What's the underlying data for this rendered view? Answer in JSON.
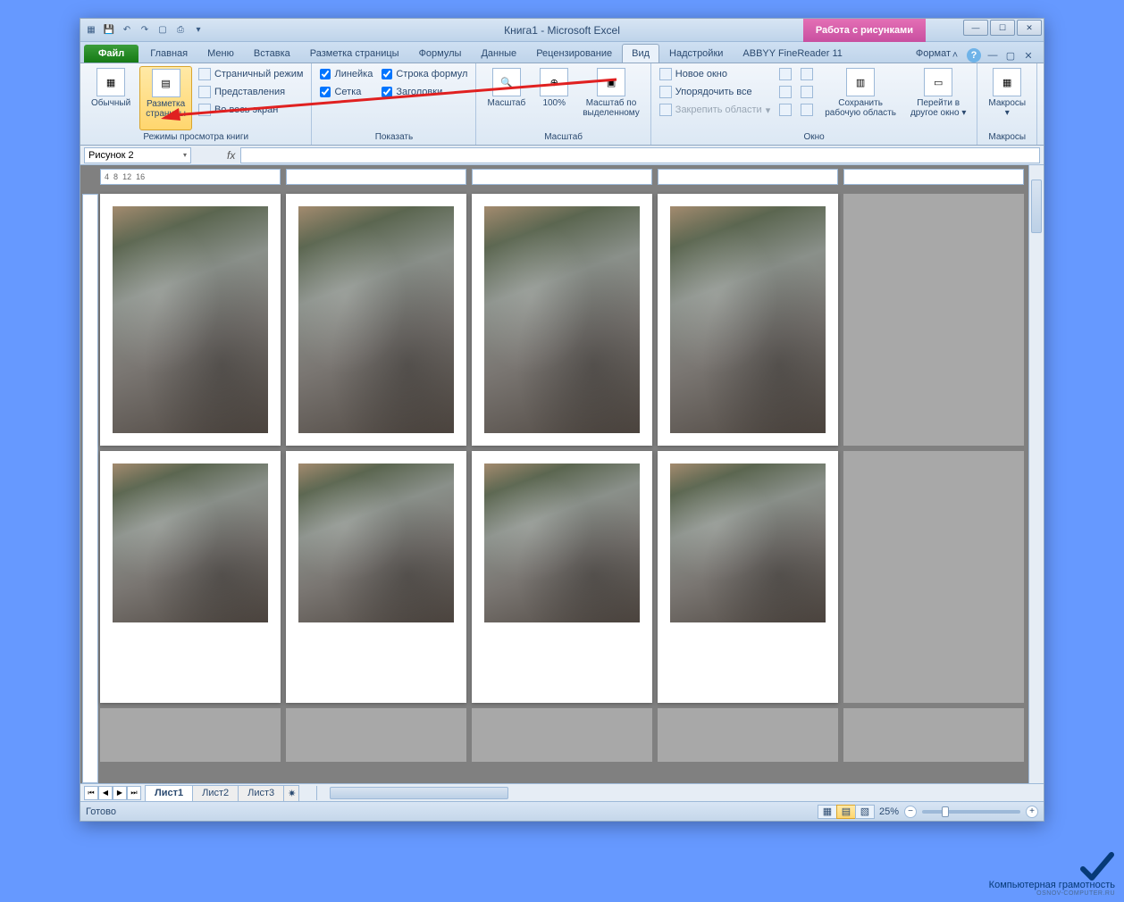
{
  "titlebar": {
    "title": "Книга1 - Microsoft Excel",
    "contextual": "Работа с рисунками"
  },
  "tabs": {
    "file": "Файл",
    "items": [
      "Главная",
      "Меню",
      "Вставка",
      "Разметка страницы",
      "Формулы",
      "Данные",
      "Рецензирование",
      "Вид",
      "Надстройки",
      "ABBYY FineReader 11"
    ],
    "active": "Вид",
    "format": "Формат"
  },
  "ribbon": {
    "views": {
      "normal": "Обычный",
      "page_layout": "Разметка\nстраницы",
      "page_break": "Страничный режим",
      "custom_views": "Представления",
      "full_screen": "Во весь экран",
      "group": "Режимы просмотра книги"
    },
    "show": {
      "ruler": "Линейка",
      "formula_bar": "Строка формул",
      "gridlines": "Сетка",
      "headings": "Заголовки",
      "group": "Показать"
    },
    "zoom": {
      "zoom": "Масштаб",
      "p100": "100%",
      "to_selection": "Масштаб по\nвыделенному",
      "group": "Масштаб"
    },
    "window": {
      "new_window": "Новое окно",
      "arrange_all": "Упорядочить все",
      "freeze": "Закрепить области",
      "save_workspace": "Сохранить\nрабочую область",
      "switch_windows": "Перейти в\nдругое окно",
      "group": "Окно"
    },
    "macros": {
      "macros": "Макросы",
      "group": "Макросы"
    }
  },
  "namebox": "Рисунок 2",
  "ruler_ticks": [
    "4",
    "8",
    "12",
    "16"
  ],
  "sheets": [
    "Лист1",
    "Лист2",
    "Лист3"
  ],
  "active_sheet": "Лист1",
  "status": {
    "ready": "Готово",
    "zoom": "25%"
  },
  "watermark": {
    "main": "Компьютерная грамотность",
    "sub": "OSNOV-COMPUTER.RU"
  }
}
